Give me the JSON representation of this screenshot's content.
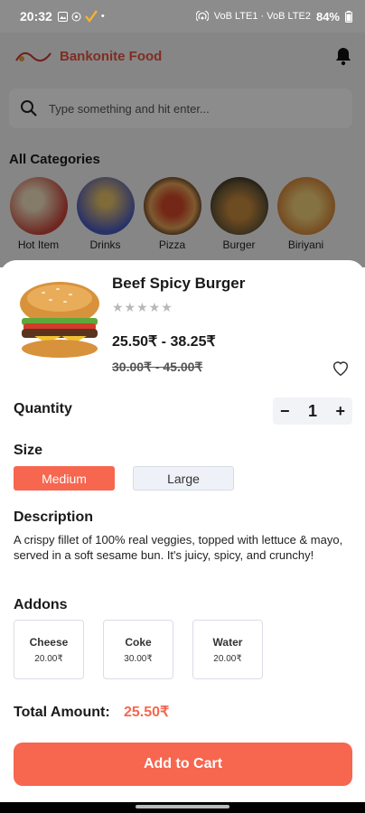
{
  "status_bar": {
    "time": "20:32",
    "network": "VoB LTE1 · VoB LTE2",
    "battery": "84%"
  },
  "app_bar": {
    "logo_text": "Bankonite",
    "brand": "Bankonite Food"
  },
  "search": {
    "placeholder": "Type something and hit enter..."
  },
  "categories": {
    "title": "All Categories",
    "items": [
      {
        "label": "Hot Item",
        "color": "#c8453a"
      },
      {
        "label": "Drinks",
        "color": "#4a5bbf"
      },
      {
        "label": "Pizza",
        "color": "#a2502d"
      },
      {
        "label": "Burger",
        "color": "#6d5a3a"
      },
      {
        "label": "Biriyani",
        "color": "#d68a3c"
      }
    ]
  },
  "product": {
    "name": "Beef Spicy Burger",
    "rating_stars": "★★★★★",
    "price_range": "25.50₹  - 38.25₹",
    "old_price_range": "30.00₹  - 45.00₹"
  },
  "quantity": {
    "label": "Quantity",
    "minus": "−",
    "value": "1",
    "plus": "+"
  },
  "size": {
    "label": "Size",
    "options": [
      "Medium",
      "Large"
    ],
    "selected": "Medium"
  },
  "description": {
    "label": "Description",
    "text": "A crispy fillet of 100% real veggies, topped with lettuce & mayo, served in a soft sesame bun. It's juicy, spicy, and crunchy!"
  },
  "addons": {
    "label": "Addons",
    "items": [
      {
        "name": "Cheese",
        "price": "20.00₹"
      },
      {
        "name": "Coke",
        "price": "30.00₹"
      },
      {
        "name": "Water",
        "price": "20.00₹"
      }
    ]
  },
  "total": {
    "label": "Total Amount:",
    "value": "25.50₹"
  },
  "cart_button": {
    "label": "Add to Cart"
  },
  "colors": {
    "accent": "#f7664f",
    "brand": "#e8533e"
  }
}
